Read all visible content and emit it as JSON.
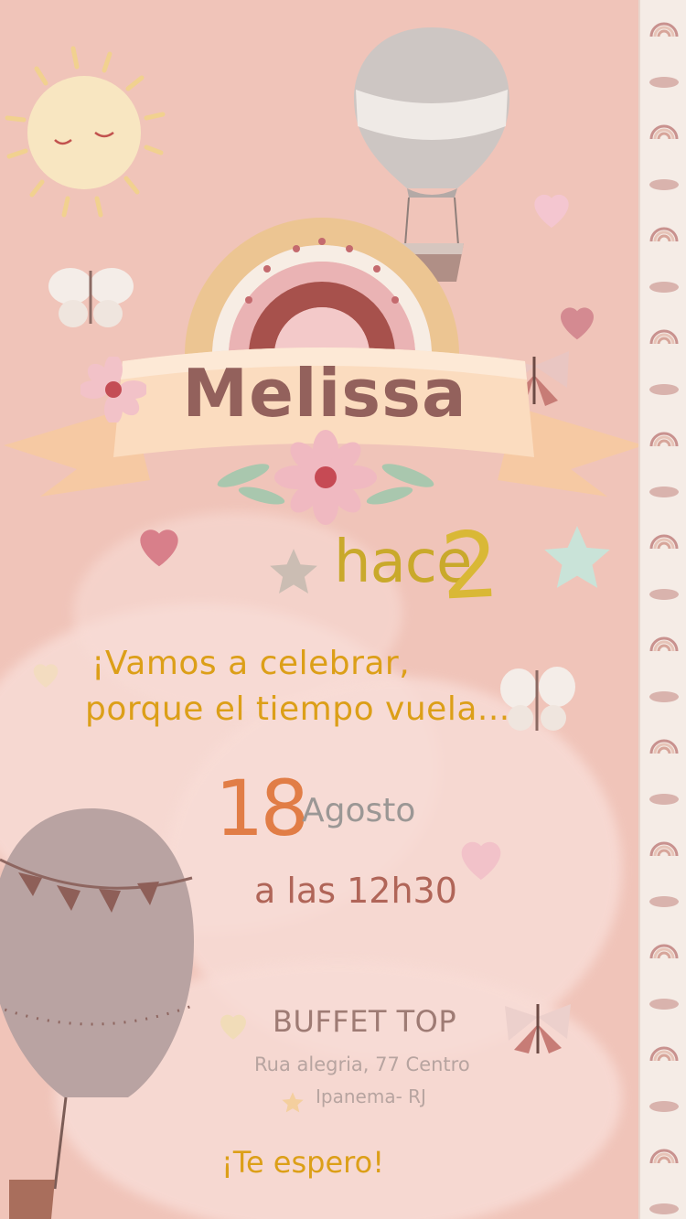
{
  "invitation": {
    "name": "Melissa",
    "age_prefix": "hace",
    "age": "2",
    "slogan_line1": "¡Vamos a celebrar,",
    "slogan_line2": "porque el tiempo vuela...",
    "day": "18",
    "month": "Agosto",
    "time": "a las 12h30",
    "venue": "BUFFET TOP",
    "address": "Rua alegria, 77 Centro",
    "city": "Ipanema- RJ",
    "closing": "¡Te espero!"
  },
  "decorations": {
    "icons": [
      "sun-icon",
      "hot-air-balloon-icon",
      "rainbow-icon",
      "heart-icon",
      "butterfly-icon",
      "flower-icon",
      "star-icon",
      "ribbon-banner-icon"
    ]
  },
  "colors": {
    "background": "#f0c4b9",
    "name": "#93615c",
    "slogan": "#dc9f18",
    "day": "#e17d46",
    "time": "#b06558"
  }
}
